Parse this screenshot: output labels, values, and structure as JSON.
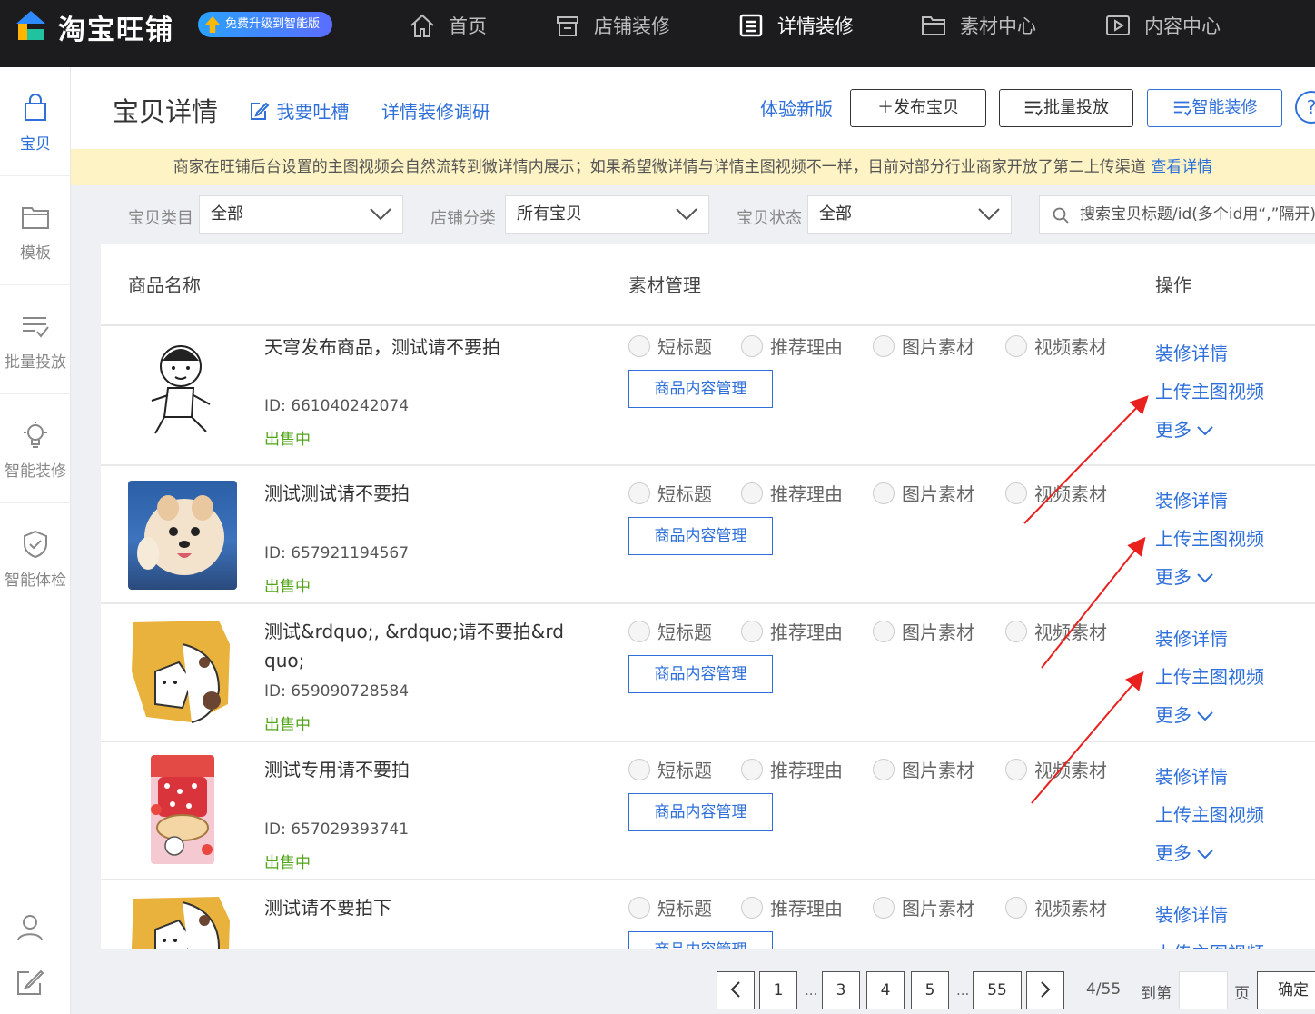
{
  "topbar": {
    "logo_text": "淘宝旺铺",
    "upgrade_label": "免费升级到智能版",
    "nav": [
      {
        "label": "首页",
        "icon": "home-icon"
      },
      {
        "label": "店铺装修",
        "icon": "store-icon"
      },
      {
        "label": "详情装修",
        "icon": "detail-icon",
        "active": true
      },
      {
        "label": "素材中心",
        "icon": "folder-icon"
      },
      {
        "label": "内容中心",
        "icon": "play-icon"
      }
    ]
  },
  "sidebar": {
    "items": [
      {
        "label": "宝贝",
        "icon": "bag-icon",
        "active": true
      },
      {
        "label": "模板",
        "icon": "folder-icon"
      },
      {
        "label": "批量投放",
        "icon": "list-check-icon"
      },
      {
        "label": "智能装修",
        "icon": "bulb-icon"
      },
      {
        "label": "智能体检",
        "icon": "shield-check-icon"
      }
    ]
  },
  "header": {
    "title": "宝贝详情",
    "feedback_link": "我要吐槽",
    "survey_link": "详情装修调研",
    "new_version_link": "体验新版",
    "publish_button": "＋发布宝贝",
    "batch_button": "批量投放",
    "smart_button": "智能装修",
    "help_label": "?"
  },
  "notice": {
    "text": "商家在旺铺后台设置的主图视频会自然流转到微详情内展示；如果希望微详情与详情主图视频不一样，目前对部分行业商家开放了第二上传渠道 ",
    "link": "查看详情"
  },
  "filters": {
    "category_label": "宝贝类目",
    "category_value": "全部",
    "shop_label": "店铺分类",
    "shop_value": "所有宝贝",
    "status_label": "宝贝状态",
    "status_value": "全部",
    "search_placeholder": "搜索宝贝标题/id(多个id用“,”隔开)"
  },
  "table": {
    "columns": [
      "商品名称",
      "素材管理",
      "操作"
    ],
    "options": [
      "短标题",
      "推荐理由",
      "图片素材",
      "视频素材"
    ],
    "manage_button": "商品内容管理",
    "actions": [
      "装修详情",
      "上传主图视频",
      "更多"
    ],
    "rows": [
      {
        "name": "天穹发布商品，测试请不要拍",
        "id": "ID: 661040242074",
        "status": "出售中"
      },
      {
        "name": "测试测试请不要拍",
        "id": "ID: 657921194567",
        "status": "出售中"
      },
      {
        "name": "测试&rdquo;, &rdquo;请不要拍&rdquo;",
        "id": "ID: 659090728584",
        "status": "出售中"
      },
      {
        "name": "测试专用请不要拍",
        "id": "ID: 657029393741",
        "status": "出售中"
      },
      {
        "name": "测试请不要拍下",
        "id": "",
        "status": ""
      }
    ]
  },
  "pagination": {
    "pages": [
      "1",
      "3",
      "4",
      "5",
      "55"
    ],
    "dots": "...",
    "info": "4/55",
    "goto_label": "到第",
    "page_unit": "页",
    "confirm": "确定"
  },
  "colors": {
    "accent": "#2e6fd9",
    "status_green": "#52a41a",
    "notice_bg": "#fdf3c4",
    "annotation_red": "#e8201e"
  }
}
